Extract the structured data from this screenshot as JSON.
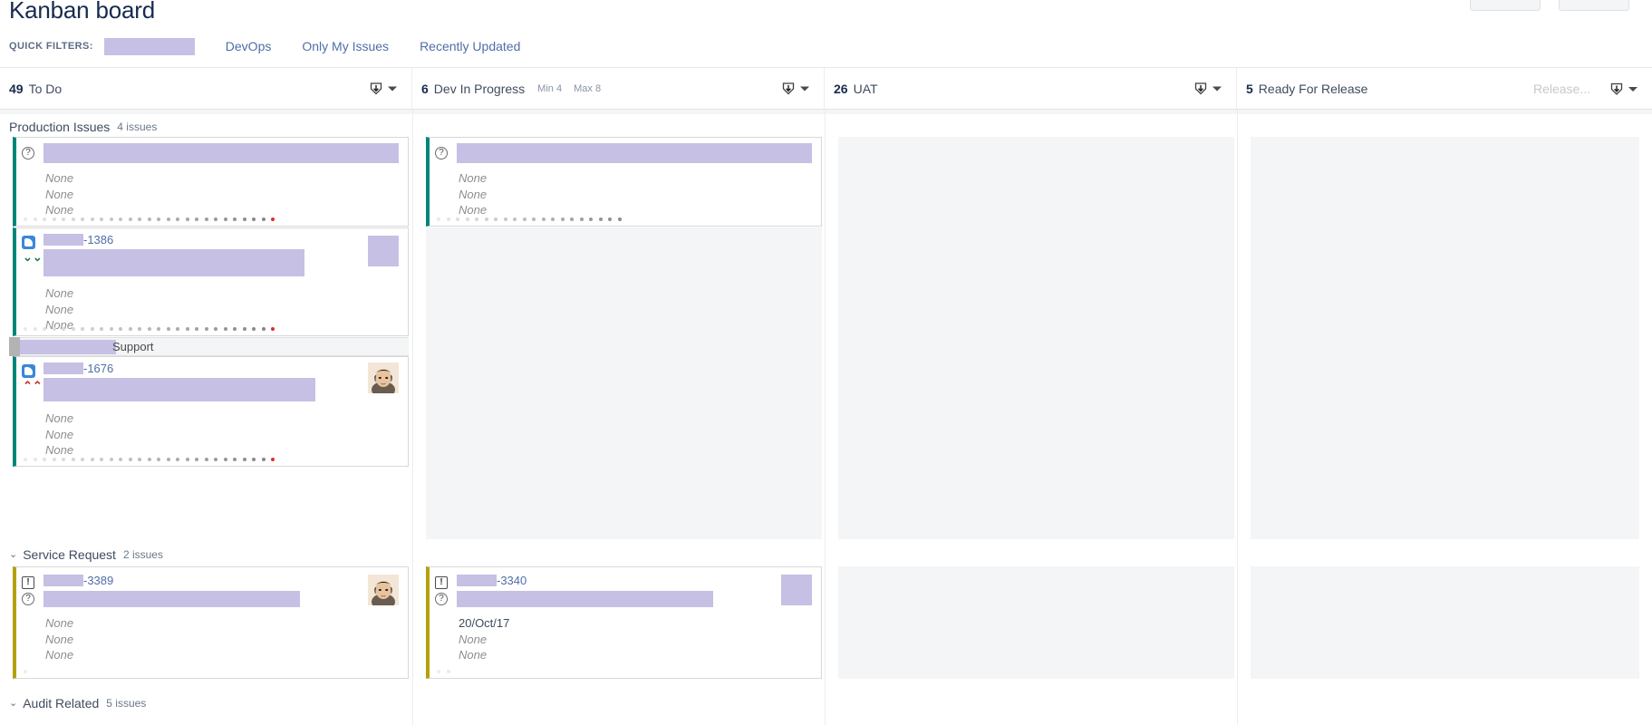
{
  "page": {
    "title": "Kanban board"
  },
  "toolbar": {
    "buttons": [
      "",
      ""
    ]
  },
  "quick_filters": {
    "label": "QUICK FILTERS:",
    "redacted_filter": "",
    "links": [
      {
        "label": "DevOps"
      },
      {
        "label": "Only My Issues"
      },
      {
        "label": "Recently Updated"
      }
    ]
  },
  "columns": [
    {
      "count": "49",
      "name": "To Do",
      "min": "",
      "max": "",
      "release_placeholder": "",
      "dropdown_icon": "download-icon"
    },
    {
      "count": "6",
      "name": "Dev In Progress",
      "min": "Min 4",
      "max": "Max 8",
      "release_placeholder": "",
      "dropdown_icon": "download-icon"
    },
    {
      "count": "26",
      "name": "UAT",
      "min": "",
      "max": "",
      "release_placeholder": "",
      "dropdown_icon": "download-icon"
    },
    {
      "count": "5",
      "name": "Ready For Release",
      "min": "",
      "max": "",
      "release_placeholder": "Release...",
      "dropdown_icon": "download-icon"
    }
  ],
  "swimlanes": [
    {
      "name": "Production Issues",
      "issues_label": "4 issues",
      "collapsed": false,
      "chevron": ""
    },
    {
      "name": "Service Request",
      "issues_label": "2 issues",
      "collapsed": false,
      "chevron": "⌄"
    },
    {
      "name": "Audit Related",
      "issues_label": "5 issues",
      "collapsed": false,
      "chevron": "⌄"
    }
  ],
  "overlay": {
    "support_label": "Support",
    "support_redacted": ""
  },
  "cards": [
    {
      "id": "card-todo-1",
      "key_redacted": "",
      "key_suffix": "",
      "summary_redacted": "",
      "fields": [
        "None",
        "None",
        "None"
      ],
      "type_icon": "question-circle-icon",
      "priority_icon": "",
      "bar_color": "#00857a",
      "avatar": "none",
      "aging_end": "red"
    },
    {
      "id": "card-todo-2",
      "key_redacted": "",
      "key_suffix": "-1386",
      "summary_redacted": "",
      "fields": [
        "None",
        "None",
        "None"
      ],
      "type_icon": "task-icon",
      "priority_icon": "priority-minor-icon",
      "bar_color": "#00857a",
      "avatar": "redacted",
      "aging_end": "red"
    },
    {
      "id": "card-todo-3",
      "key_redacted": "",
      "key_suffix": "-1676",
      "summary_redacted": "",
      "fields": [
        "None",
        "None",
        "None"
      ],
      "type_icon": "task-icon",
      "priority_icon": "priority-major-icon",
      "bar_color": "#00857a",
      "avatar": "photo",
      "aging_end": "red"
    },
    {
      "id": "card-dev-1",
      "key_redacted": "",
      "key_suffix": "",
      "summary_redacted": "",
      "fields": [
        "None",
        "None",
        "None"
      ],
      "type_icon": "question-circle-icon",
      "priority_icon": "",
      "bar_color": "#00857a",
      "avatar": "none",
      "aging_end": "gray"
    },
    {
      "id": "card-sr-todo",
      "key_redacted": "",
      "key_suffix": "-3389",
      "summary_redacted": "",
      "fields": [
        "None",
        "None",
        "None"
      ],
      "type_icon": "alert-square-icon",
      "priority_icon": "question-circle-icon",
      "bar_color": "#b5a10d",
      "avatar": "photo",
      "aging_end": "gray"
    },
    {
      "id": "card-sr-dev",
      "key_redacted": "",
      "key_suffix": "-3340",
      "summary_redacted": "",
      "fields": [
        "20/Oct/17",
        "None",
        "None"
      ],
      "type_icon": "alert-square-icon",
      "priority_icon": "question-circle-icon",
      "bar_color": "#b5a10d",
      "avatar": "redacted",
      "aging_end": "gray"
    }
  ],
  "colors": {
    "redaction": "#c5c0e4",
    "card_bar_teal": "#00857a",
    "card_bar_olive": "#b5a10d",
    "link": "#4f6ea8",
    "aging_red": "#d93025",
    "dropzone": "#f4f5f7"
  }
}
